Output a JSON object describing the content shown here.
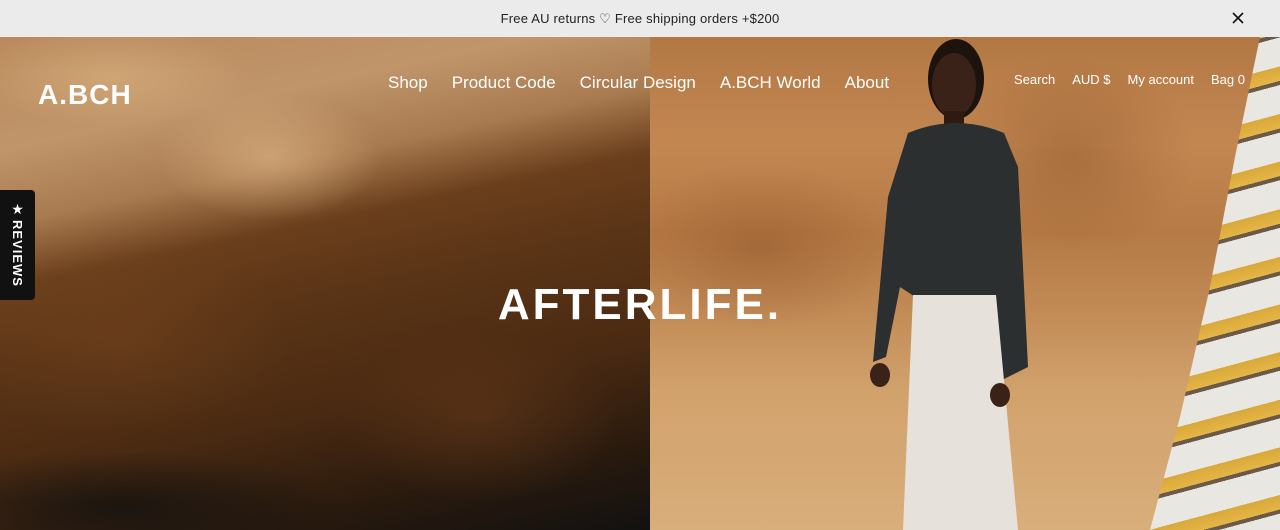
{
  "announcement": {
    "text": "Free AU returns ♡ Free shipping orders +$200",
    "close_icon": "close-icon"
  },
  "header": {
    "logo": "A.BCH",
    "main_nav": [
      "Shop",
      "Product Code",
      "Circular Design",
      "A.BCH World",
      "About"
    ],
    "util_nav": {
      "search": "Search",
      "currency": "AUD $",
      "account": "My account",
      "bag": "Bag 0"
    }
  },
  "reviews_tab": {
    "icon": "star-icon",
    "label": "REVIEWS"
  },
  "hero": {
    "headline": "AFTERLIFE."
  }
}
